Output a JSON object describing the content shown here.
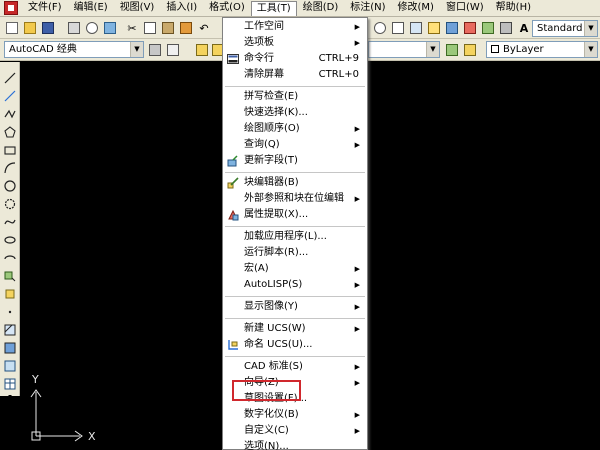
{
  "menubar": {
    "items": [
      "文件(F)",
      "编辑(E)",
      "视图(V)",
      "插入(I)",
      "格式(O)",
      "工具(T)",
      "绘图(D)",
      "标注(N)",
      "修改(M)",
      "窗口(W)",
      "帮助(H)"
    ]
  },
  "toolbar": {
    "workspace": "AutoCAD 经典",
    "text_style": "Standard",
    "layer_style": "ByLayer"
  },
  "dropdown": {
    "items": [
      {
        "label": "工作空间",
        "shortcut": "",
        "submenu": true,
        "icon": ""
      },
      {
        "label": "选项板",
        "shortcut": "",
        "submenu": true,
        "icon": ""
      },
      {
        "label": "命令行",
        "shortcut": "CTRL+9",
        "submenu": false,
        "icon": "command-line-icon"
      },
      {
        "label": "清除屏幕",
        "shortcut": "CTRL+0",
        "submenu": false,
        "icon": ""
      },
      {
        "label": "拼写检查(E)",
        "shortcut": "",
        "submenu": false,
        "icon": ""
      },
      {
        "label": "快速选择(K)...",
        "shortcut": "",
        "submenu": false,
        "icon": ""
      },
      {
        "label": "绘图顺序(O)",
        "shortcut": "",
        "submenu": true,
        "icon": ""
      },
      {
        "label": "查询(Q)",
        "shortcut": "",
        "submenu": true,
        "icon": ""
      },
      {
        "label": "更新字段(T)",
        "shortcut": "",
        "submenu": false,
        "icon": "update-field-icon"
      },
      {
        "label": "块编辑器(B)",
        "shortcut": "",
        "submenu": false,
        "icon": "block-editor-icon"
      },
      {
        "label": "外部参照和块在位编辑",
        "shortcut": "",
        "submenu": true,
        "icon": ""
      },
      {
        "label": "属性提取(X)...",
        "shortcut": "",
        "submenu": false,
        "icon": "attribute-extract-icon"
      },
      {
        "label": "加载应用程序(L)...",
        "shortcut": "",
        "submenu": false,
        "icon": ""
      },
      {
        "label": "运行脚本(R)...",
        "shortcut": "",
        "submenu": false,
        "icon": ""
      },
      {
        "label": "宏(A)",
        "shortcut": "",
        "submenu": true,
        "icon": ""
      },
      {
        "label": "AutoLISP(S)",
        "shortcut": "",
        "submenu": true,
        "icon": ""
      },
      {
        "label": "显示图像(Y)",
        "shortcut": "",
        "submenu": true,
        "icon": ""
      },
      {
        "label": "新建 UCS(W)",
        "shortcut": "",
        "submenu": true,
        "icon": ""
      },
      {
        "label": "命名 UCS(U)...",
        "shortcut": "",
        "submenu": false,
        "icon": "named-ucs-icon"
      },
      {
        "label": "CAD 标准(S)",
        "shortcut": "",
        "submenu": true,
        "icon": ""
      },
      {
        "label": "向导(Z)",
        "shortcut": "",
        "submenu": true,
        "icon": ""
      },
      {
        "label": "草图设置(F)...",
        "shortcut": "",
        "submenu": false,
        "icon": ""
      },
      {
        "label": "数字化仪(B)",
        "shortcut": "",
        "submenu": true,
        "icon": ""
      },
      {
        "label": "自定义(C)",
        "shortcut": "",
        "submenu": true,
        "icon": ""
      },
      {
        "label": "选项(N)...",
        "shortcut": "",
        "submenu": false,
        "icon": ""
      }
    ]
  },
  "ucs": {
    "x_label": "X",
    "y_label": "Y"
  },
  "colors": {
    "highlight": "#d0282d",
    "menu_bg": "#ece9d8",
    "canvas_bg": "#000000"
  }
}
